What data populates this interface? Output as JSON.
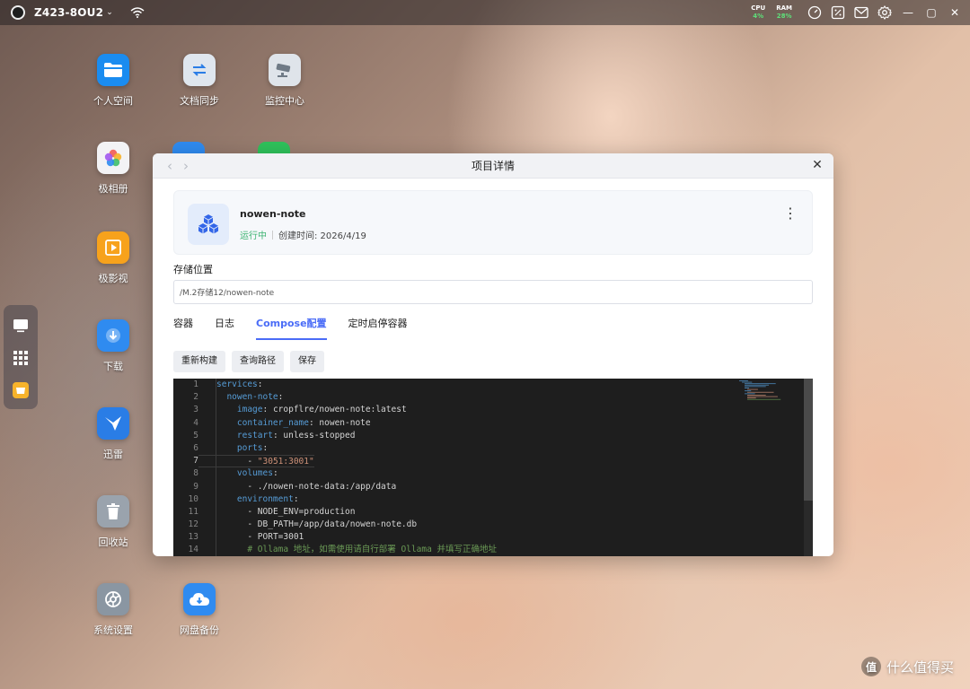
{
  "topbar": {
    "device_name": "Z423-8OU2",
    "chevron": "⌄",
    "cpu_label": "CPU",
    "cpu_value": "4%",
    "ram_label": "RAM",
    "ram_value": "28%",
    "icons": [
      "speedometer-icon",
      "percent-icon",
      "mail-icon",
      "gear-icon"
    ],
    "window_controls": [
      "minimize",
      "maximize",
      "close"
    ]
  },
  "desktop_icons": [
    {
      "label": "个人空间",
      "icon": "folder-icon",
      "color": "#1a8cf0"
    },
    {
      "label": "文档同步",
      "icon": "sync-icon",
      "color": "#dfe6ee"
    },
    {
      "label": "监控中心",
      "icon": "camera-icon",
      "color": "#dfe4ea"
    },
    {
      "label": "极相册",
      "icon": "photos-icon",
      "color": "#f3f3f5"
    },
    {
      "label": "极影视",
      "icon": "video-icon",
      "color": "#f7a21c"
    },
    {
      "label": "下载",
      "icon": "download-icon",
      "color": "#2f8bf0"
    },
    {
      "label": "迅雷",
      "icon": "thunder-icon",
      "color": "#2a7de6"
    },
    {
      "label": "回收站",
      "icon": "trash-icon",
      "color": "#9aa3ad"
    },
    {
      "label": "系统设置",
      "icon": "settings-icon",
      "color": "#8a96a2"
    },
    {
      "label": "网盘备份",
      "icon": "cloud-icon",
      "color": "#2f8bf0"
    }
  ],
  "window": {
    "title": "项目详情",
    "back": "‹",
    "forward": "›",
    "close": "✕"
  },
  "project": {
    "name": "nowen-note",
    "status": "运行中",
    "created": "创建时间: 2026/4/19",
    "more": "⋮"
  },
  "storage": {
    "label": "存储位置",
    "path": "/M.2存储12/nowen-note"
  },
  "tabs": [
    "容器",
    "日志",
    "Compose配置",
    "定时启停容器"
  ],
  "active_tab": "Compose配置",
  "actions": [
    "重新构建",
    "查询路径",
    "保存"
  ],
  "code_lines": [
    {
      "n": "1",
      "indent": "",
      "key": "services",
      "sep": ":",
      "val": "",
      "type": "key"
    },
    {
      "n": "2",
      "indent": "  ",
      "key": "nowen-note",
      "sep": ":",
      "val": "",
      "type": "key"
    },
    {
      "n": "3",
      "indent": "    ",
      "key": "image",
      "sep": ": ",
      "val": "cropflre/nowen-note:latest",
      "type": "key"
    },
    {
      "n": "4",
      "indent": "    ",
      "key": "container_name",
      "sep": ": ",
      "val": "nowen-note",
      "type": "key"
    },
    {
      "n": "5",
      "indent": "    ",
      "key": "restart",
      "sep": ": ",
      "val": "unless-stopped",
      "type": "key"
    },
    {
      "n": "6",
      "indent": "    ",
      "key": "ports",
      "sep": ":",
      "val": "",
      "type": "key"
    },
    {
      "n": "7",
      "indent": "      ",
      "key": "- ",
      "sep": "",
      "val": "\"3051:3001\"",
      "type": "str"
    },
    {
      "n": "8",
      "indent": "    ",
      "key": "volumes",
      "sep": ":",
      "val": "",
      "type": "key"
    },
    {
      "n": "9",
      "indent": "      ",
      "key": "- ",
      "sep": "",
      "val": "./nowen-note-data:/app/data",
      "type": "str"
    },
    {
      "n": "10",
      "indent": "    ",
      "key": "environment",
      "sep": ":",
      "val": "",
      "type": "key"
    },
    {
      "n": "11",
      "indent": "      ",
      "key": "- ",
      "sep": "",
      "val": "NODE_ENV=production",
      "type": "str"
    },
    {
      "n": "12",
      "indent": "      ",
      "key": "- ",
      "sep": "",
      "val": "DB_PATH=/app/data/nowen-note.db",
      "type": "str"
    },
    {
      "n": "13",
      "indent": "      ",
      "key": "- ",
      "sep": "",
      "val": "PORT=3001",
      "type": "str"
    },
    {
      "n": "14",
      "indent": "      ",
      "key": "",
      "sep": "",
      "val": "# Ollama 地址，如需使用请自行部署 Ollama 并填写正确地址",
      "type": "comment"
    }
  ],
  "current_line": "7",
  "watermark": {
    "badge": "值",
    "text": "什么值得买"
  }
}
